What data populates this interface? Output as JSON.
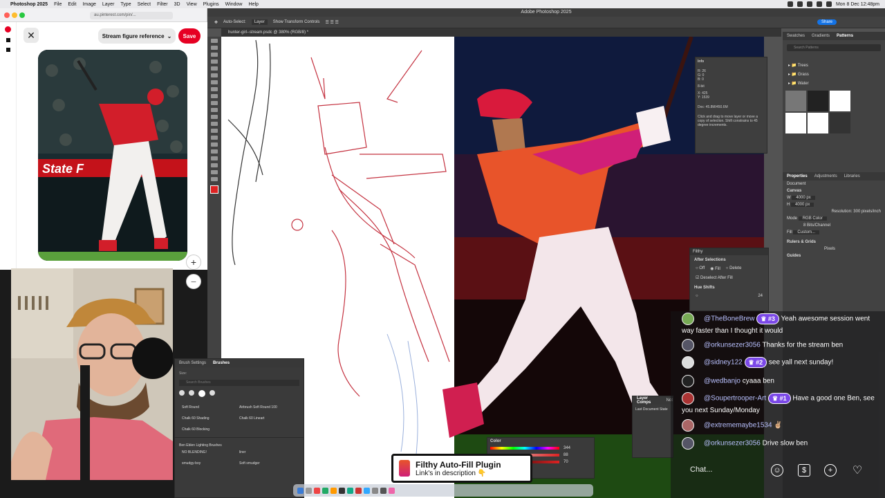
{
  "menubar": {
    "apple": "",
    "app_name": "Photoshop 2025",
    "items": [
      "File",
      "Edit",
      "Image",
      "Layer",
      "Type",
      "Select",
      "Filter",
      "3D",
      "View",
      "Plugins",
      "Window",
      "Help"
    ],
    "clock": "Mon 8 Dec  12:48pm"
  },
  "browser": {
    "url": "au.pinterest.com/pin/...",
    "close_label": "✕",
    "board_label": "Stream figure reference",
    "save_label": "Save",
    "zoom_in": "+",
    "zoom_out": "−",
    "brand_color": "#e60023",
    "pin_banner_text": "State F"
  },
  "photoshop": {
    "window_title": "Adobe Photoshop 2025",
    "options": {
      "auto_select": "Auto-Select:",
      "layer": "Layer",
      "transform": "Show Transform Controls"
    },
    "doc_tab": "hunter-girl--stream.psdc @ 380% (RGB/8) *",
    "share": "Share",
    "right_tabs": [
      "Swatches",
      "Gradients",
      "Patterns"
    ],
    "search_placeholder": "Search Patterns",
    "pattern_folders": [
      "Trees",
      "Grass",
      "Water"
    ],
    "props_tabs": [
      "Properties",
      "Adjustments",
      "Libraries"
    ],
    "props": {
      "document": "Document",
      "canvas": "Canvas",
      "w": "4000 px",
      "h": "4000 px",
      "resolution": "Resolution: 300 pixels/inch",
      "mode_label": "Mode",
      "mode": "RGB Color",
      "bits": "8 Bits/Channel",
      "fill_label": "Fill",
      "fill": "Custom...",
      "rulers": "Rulers & Grids",
      "units": "Pixels",
      "guides": "Guides"
    },
    "info": {
      "title": "Info",
      "r": "R:  26",
      "g": "G:  0",
      "b": "B:  0",
      "bit": "8-bit",
      "x": "X:  425",
      "y": "Y:  1539",
      "doc": "Doc: 45.8M/450.6M",
      "hint": "Click and drag to move layer or move a copy of selection. Shift constrains to 45 degree increments."
    },
    "filthy": {
      "title": "Filthy",
      "after_selections": "After Selections",
      "off": "Off",
      "fill": "Fill",
      "delete": "Delete",
      "deselect": "Deselect After Fill",
      "hue_shifts": "Hue Shifts",
      "hue_value": "24"
    },
    "brushes": {
      "tabs": [
        "Brush Settings",
        "Brushes"
      ],
      "size_label": "Size:",
      "search_placeholder": "Search Brushes",
      "items": [
        "Soft Round",
        "Airbrush Soft Round 100",
        "Chalk 60 Shading",
        "Chalk 60 Lineart",
        "Chalk 60 Blocking"
      ],
      "group": "Ben Eblen Lighting Brushes",
      "group_items": [
        "NO BLENDING!",
        "liner",
        "smudgy-boy",
        "Soft smudger"
      ]
    },
    "color": {
      "title": "Color",
      "values": [
        "344",
        "88",
        "70"
      ]
    },
    "layer_comps": {
      "tabs": [
        "Layer Comps",
        "Not"
      ],
      "item": "Last Document State"
    }
  },
  "chat": {
    "messages": [
      {
        "user": "@TheBoneBrew",
        "badge": "#3",
        "text": "Yeah awesome session went way faster than I thought it would"
      },
      {
        "user": "@orkunsezer3056",
        "badge": "",
        "text": "Thanks for the stream ben"
      },
      {
        "user": "@sidney122",
        "badge": "#2",
        "text": "see yall next sunday!"
      },
      {
        "user": "@wedbanjo",
        "badge": "",
        "text": "cyaaa ben"
      },
      {
        "user": "@Soupertrooper-Art",
        "badge": "#1",
        "text": "Have a good one Ben, see you next Sunday/Monday"
      },
      {
        "user": "@extrememaybe1534",
        "badge": "",
        "text": "✌🏼"
      },
      {
        "user": "@orkunsezer3056",
        "badge": "",
        "text": "Drive slow ben"
      }
    ],
    "input_placeholder": "Chat...",
    "badge_color": "#7b48e8"
  },
  "banner": {
    "title": "Filthy Auto-Fill Plugin",
    "subtitle": "Link's in description 👇"
  }
}
